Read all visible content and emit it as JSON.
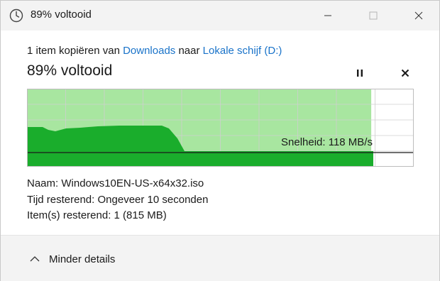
{
  "window": {
    "title": "89% voltooid",
    "icon": "clock-icon"
  },
  "copy": {
    "prefix": "1 item kopiëren van",
    "source": "Downloads",
    "middle": "naar",
    "destination": "Lokale schijf (D:)"
  },
  "status": {
    "percent_text": "89% voltooid",
    "progress": 0.89,
    "speed": "Snelheid: 118 MB/s"
  },
  "details": {
    "name_label": "Naam:",
    "name_value": "Windows10EN-US-x64x32.iso",
    "time_label": "Tijd resterend:",
    "time_value": "Ongeveer 10 seconden",
    "items_label": "Item(s) resterend:",
    "items_value": "1 (815 MB)"
  },
  "footer": {
    "toggle_label": "Minder details"
  },
  "colors": {
    "progress_fill": "#a8e6a0",
    "speed_fill": "#1aad2c",
    "grid": "#cfcfcf",
    "link": "#1a73c9"
  }
}
